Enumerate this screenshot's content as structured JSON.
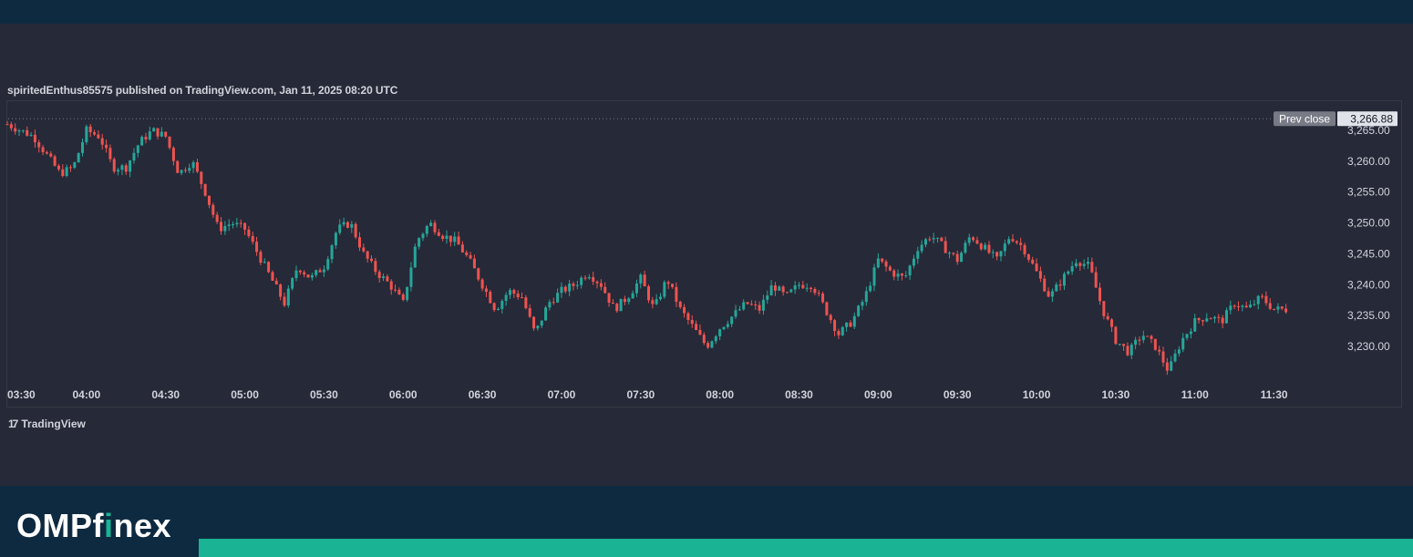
{
  "header": {
    "published_text": "spiritedEnthus85575 published on TradingView.com, Jan 11, 2025 08:20 UTC"
  },
  "logo": {
    "mark": "17",
    "text": "TradingView"
  },
  "brand": {
    "part1": "OMP",
    "part2": "f",
    "part3": "i",
    "part4": "nex"
  },
  "colors": {
    "up": "#26a69a",
    "down": "#ef5350",
    "panel_bg": "#262937",
    "footer_bg": "#0e2a40",
    "footer_bar": "#1ab394",
    "axis_text": "#d1d4dc",
    "prev_close_label_bg": "#787b86"
  },
  "chart_data": {
    "type": "candlestick",
    "title": "",
    "xlabel": "",
    "ylabel": "",
    "ylim": [
      3225.5,
      3268.5
    ],
    "x_ticks": [
      "03:30",
      "04:00",
      "04:30",
      "05:00",
      "05:30",
      "06:00",
      "06:30",
      "07:00",
      "07:30",
      "08:00",
      "08:30",
      "09:00",
      "09:30",
      "10:00",
      "10:30",
      "11:00",
      "11:30"
    ],
    "y_ticks": [
      "3,230.00",
      "3,235.00",
      "3,240.00",
      "3,245.00",
      "3,250.00",
      "3,255.00",
      "3,260.00",
      "3,265.00"
    ],
    "y_tick_values": [
      3230,
      3235,
      3240,
      3245,
      3250,
      3255,
      3260,
      3265
    ],
    "prev_close": {
      "label": "Prev close",
      "value": 3266.88,
      "value_text": "3,266.88"
    },
    "path_minutes": [
      0,
      5,
      10,
      15,
      20,
      25,
      30,
      35,
      40,
      45,
      50,
      55,
      60,
      65,
      70,
      75,
      80,
      85,
      90,
      95,
      100,
      105,
      110,
      115,
      120,
      125,
      130,
      135,
      140,
      145,
      150,
      155,
      160,
      165,
      170,
      175,
      180,
      185,
      190,
      195,
      200,
      205,
      210,
      215,
      220,
      225,
      230,
      235,
      240,
      245,
      250,
      255,
      260,
      265,
      270,
      275,
      280,
      285,
      290,
      295,
      300,
      305,
      310,
      315,
      320,
      325,
      330,
      335,
      340,
      345,
      350,
      355,
      360,
      365,
      370,
      375,
      380,
      385,
      390,
      395,
      400,
      405,
      410,
      415,
      420,
      425,
      430,
      435,
      440,
      445,
      450,
      455,
      460,
      465,
      470,
      475,
      480,
      485
    ],
    "path_prices": [
      3266,
      3265,
      3264,
      3261,
      3258,
      3259,
      3265,
      3264,
      3259,
      3259,
      3263,
      3265,
      3264,
      3258,
      3260,
      3255,
      3249,
      3250,
      3249,
      3245,
      3241,
      3237,
      3243,
      3241,
      3243,
      3249,
      3250,
      3245,
      3242,
      3240,
      3237,
      3247,
      3250,
      3248,
      3247,
      3244,
      3240,
      3236,
      3239,
      3238,
      3232,
      3237,
      3239,
      3240,
      3242,
      3240,
      3236,
      3238,
      3241,
      3236,
      3241,
      3236,
      3233,
      3230,
      3233,
      3235,
      3237,
      3236,
      3240,
      3238,
      3240,
      3240,
      3236,
      3232,
      3234,
      3238,
      3244,
      3242,
      3241,
      3246,
      3248,
      3246,
      3244,
      3248,
      3246,
      3244,
      3248,
      3246,
      3242,
      3238,
      3241,
      3244,
      3243,
      3236,
      3231,
      3229,
      3232,
      3230,
      3226,
      3231,
      3234,
      3235,
      3234,
      3237,
      3236,
      3238,
      3236,
      3236
    ]
  }
}
